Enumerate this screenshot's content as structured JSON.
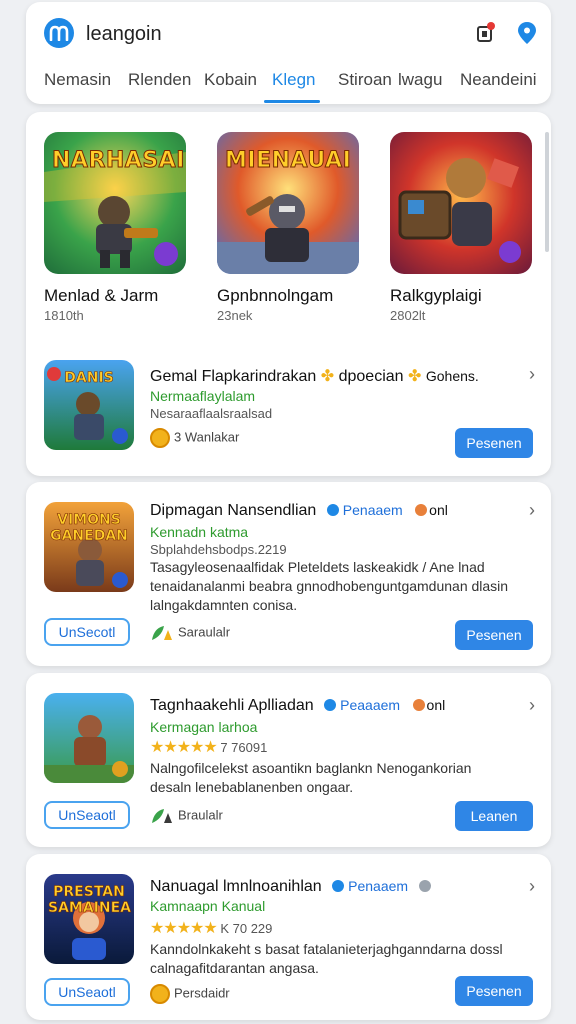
{
  "header": {
    "app_name": "leangoin",
    "tabs": [
      {
        "label": "Nemasin"
      },
      {
        "label": "Rlenden"
      },
      {
        "label": "Kobain"
      },
      {
        "label": "Klegn"
      },
      {
        "label": "Stiroan"
      },
      {
        "label": "lwagu"
      },
      {
        "label": "Neandeini"
      }
    ],
    "active_tab": "Klegn",
    "accent_color": "#1e88e5",
    "icons": [
      "m-logo",
      "notification-icon",
      "location-pin-icon"
    ]
  },
  "featured": [
    {
      "art_title": "NARHASAI",
      "name": "Menlad & Jarm",
      "sub": "1810th"
    },
    {
      "art_title": "MIENAUAI",
      "name": "Gpnbnnolngam",
      "sub": "23nek"
    },
    {
      "art_title": "",
      "name": "Ralkgyplaigi",
      "sub": "2802lt"
    }
  ],
  "first_row": {
    "art_title": "DANIS",
    "title_a": "Gemal Flapkarindrakan",
    "title_b": "dpoecian",
    "title_c": "Gohens.",
    "green": "Nermaaflaylalam",
    "gray": "Nesaraaflaalsraalsad",
    "meta": "3 Wanlakar",
    "button": "Pesenen"
  },
  "apps": [
    {
      "art_title": "VIMONS GANEDAN",
      "title": "Dipmagan Nansendlian",
      "badge": "Penaaem",
      "badge2": "onl",
      "green": "Kennadn katma",
      "gray": "Sbplahdehsbodps.2219",
      "desc": "Tasagyleosenaalfidak Pleteldets laskeakidk / Ane lnad tenaidanalanmi beabra gnnodhobenguntgamdunan dlasin lalngakdamnten conisa.",
      "meta": "Saraulalr",
      "outline_button": "UnSecotl",
      "button": "Pesenen"
    },
    {
      "art_title": "",
      "title": "Tagnhaakehli Aplliadan",
      "badge": "Peaaaem",
      "badge2": "onl",
      "green": "Kermagan larhoa",
      "rating": "7 76091",
      "desc": "Nalngofilcelekst asoantikn baglankn Nenogankorian desaln lenebablanenben ongaar.",
      "meta": "Braulalr",
      "outline_button": "UnSeaotl",
      "button": "Leanen"
    },
    {
      "art_title": "PRESTAN SAMAINEA",
      "title": "Nanuagal lmnlnoanihlan",
      "badge": "Penaaem",
      "badge2": "",
      "green": "Kamnaapn Kanual",
      "rating": "K 70 229",
      "desc": "Kanndolnkakeht s basat fatalanieterjaghganndarna dossl calnagafitdarantan angasa.",
      "meta": "Persdaidr",
      "outline_button": "UnSeaotl",
      "button": "Pesenen"
    }
  ]
}
